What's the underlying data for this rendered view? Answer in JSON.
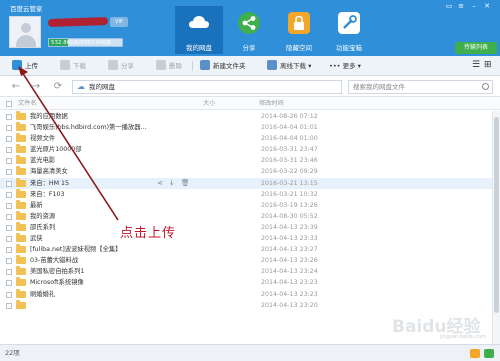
{
  "app": {
    "title": "百度云管家",
    "quota_text": "532.86GB/2057.00GB",
    "quota_fraction": 0.26,
    "vip_badge": "VIP"
  },
  "nav": [
    {
      "label": "我的网盘",
      "icon": "cloud-icon",
      "active": true,
      "color": "#ffffff"
    },
    {
      "label": "分享",
      "icon": "share-icon",
      "active": false,
      "color": "#3fae4c"
    },
    {
      "label": "隐藏空间",
      "icon": "lock-icon",
      "active": false,
      "color": "#f2a62a"
    },
    {
      "label": "功能宝箱",
      "icon": "tools-icon",
      "active": false,
      "color": "#ffffff"
    }
  ],
  "transfer_button": "传输列表",
  "toolbar": {
    "upload": "上传",
    "download": "下载",
    "share": "分享",
    "delete": "删除",
    "new_folder": "新建文件夹",
    "offline_download": "离线下载",
    "more": "更多"
  },
  "breadcrumb": {
    "root": "我的网盘"
  },
  "search": {
    "placeholder": "搜索我的网盘文件"
  },
  "columns": {
    "name": "文件名",
    "size": "大小",
    "modified": "修改时间"
  },
  "files": [
    {
      "name": "我的应用数据",
      "date": "2014-08-26 07:12"
    },
    {
      "name": "飞哥娱乐(bbs.hdbird.com)第一播放器...",
      "date": "2016-04-04 01:01"
    },
    {
      "name": "视频文件",
      "date": "2016-04-04 01:00"
    },
    {
      "name": "蓝光原片10000部",
      "date": "2016-03-31 23:47"
    },
    {
      "name": "蓝光电影",
      "date": "2016-03-31 23:46"
    },
    {
      "name": "海量高清美女",
      "date": "2016-03-22 09:29"
    },
    {
      "name": "来自：HM 15",
      "date": "2016-03-21 13:15"
    },
    {
      "name": "来自：F103",
      "date": "2016-03-21 10:32"
    },
    {
      "name": "最新",
      "date": "2016-03-19 13:26"
    },
    {
      "name": "我的资源",
      "date": "2014-08-30 05:52"
    },
    {
      "name": "邵氏系列",
      "date": "2014-04-13 23:39"
    },
    {
      "name": "武侠",
      "date": "2014-04-13 23:33"
    },
    {
      "name": "[fuliba.net]波波妹视频【全集】",
      "date": "2014-04-13 23:27"
    },
    {
      "name": "03-苗蕾大蜡料战",
      "date": "2014-04-13 23:26"
    },
    {
      "name": "美国私密自拍系列1",
      "date": "2014-04-13 23:24"
    },
    {
      "name": "Microsoft系统镜像",
      "date": "2014-04-13 23:23"
    },
    {
      "name": "刷婚婚礼",
      "date": "2014-04-13 23:23"
    },
    {
      "name": "",
      "date": "2014-04-13 23:20"
    }
  ],
  "status": {
    "count": "22项"
  },
  "annotation": {
    "text": "点击上传",
    "color": "#8b1a1a"
  },
  "watermark": {
    "text": "Baidu经验",
    "sub": "jingyan.baidu.com"
  }
}
